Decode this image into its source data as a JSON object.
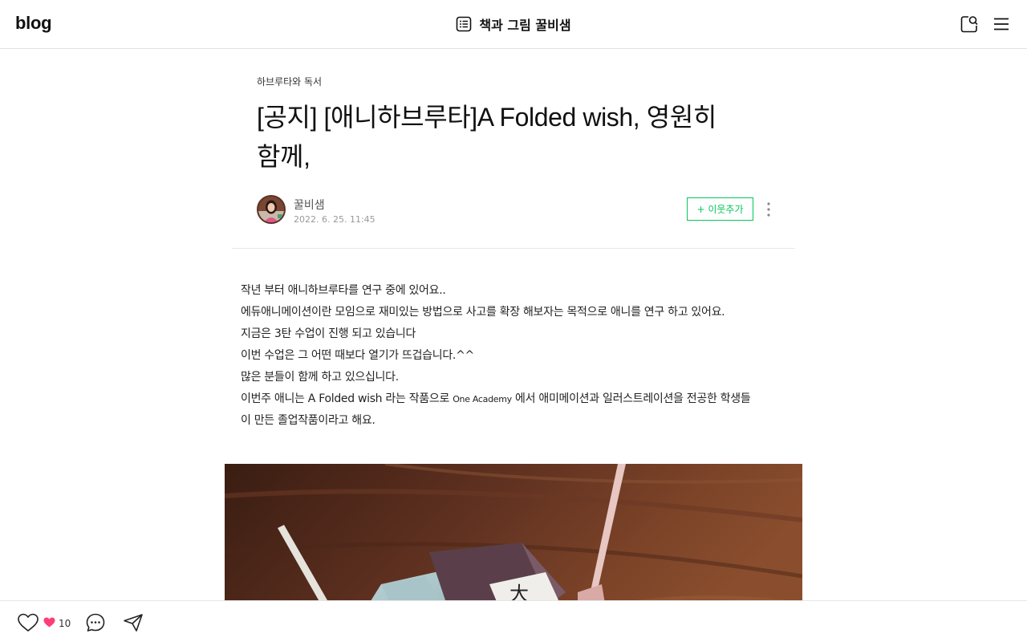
{
  "header": {
    "logo": "blog",
    "blog_title": "책과 그림 꿀비샘",
    "icons": [
      "list-icon",
      "search-icon",
      "menu-icon"
    ]
  },
  "post": {
    "category": "하브루타와 독서",
    "title_line1": "[공지] [애니하브루타]A Folded wish,  영원히",
    "title_line2": "함께,",
    "author": "꿀비샘",
    "date": "2022. 6. 25. 11:45",
    "follow_label": "+ 이웃추가",
    "body": {
      "line1": " 작년 부터 애니하브루타를 연구 중에 있어요..",
      "line2": "에듀애니메이션이란 모임으로 재미있는 방법으로 사고를 확장 해보자는 목적으로 애니를 연구 하고 있어요.",
      "line3": "지금은 3탄 수업이 진행 되고 있습니다",
      "line4": "이번 수업은 그 어떤 때보다 열기가 뜨겁습니다.^^",
      "line5": "많은 분들이 함께 하고 있으십니다.",
      "line6_a": "이번주 애니는 A Folded wish 라는 작품으로 ",
      "line6_b": "One Academy",
      "line6_c": " 에서 애미메이션과 일러스트레이션을 전공한 학생들",
      "line7": "이 만든 졸업작품이라고 해요."
    }
  },
  "bottom_bar": {
    "like_count": "10",
    "icons": [
      "heart-outline-icon",
      "heart-filled-icon",
      "comment-icon",
      "share-icon"
    ]
  },
  "colors": {
    "accent_green": "#03c75a",
    "heart_pink": "#ff3e79"
  }
}
